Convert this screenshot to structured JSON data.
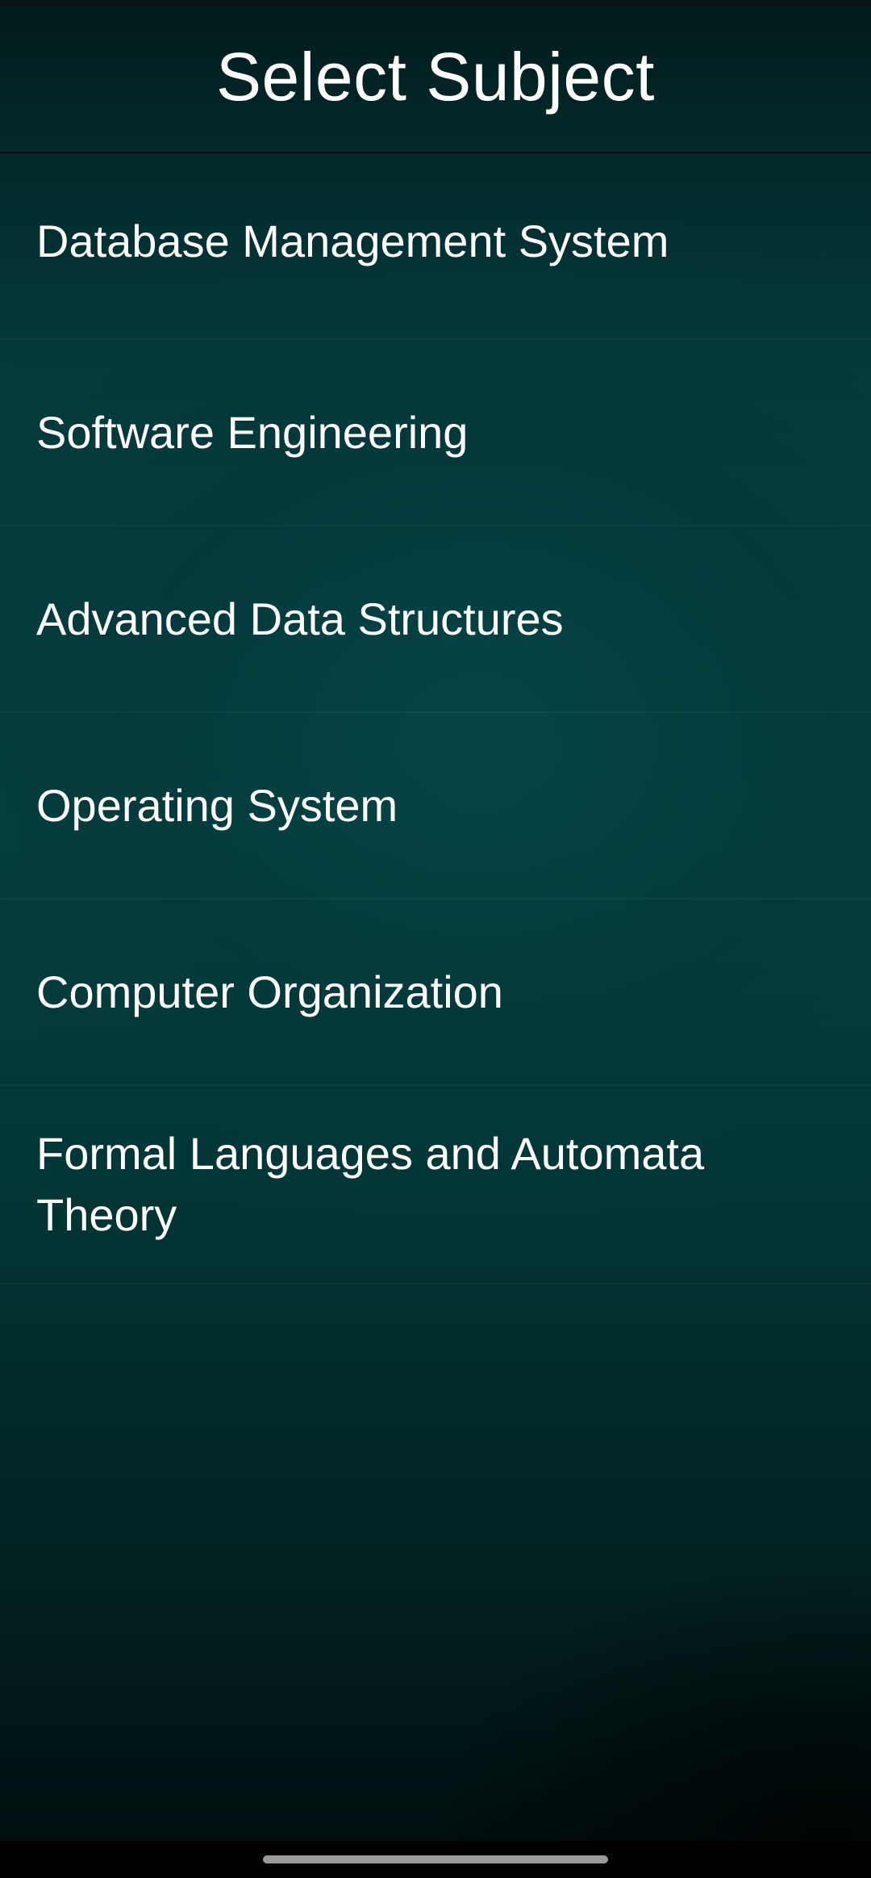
{
  "header": {
    "title": "Select Subject"
  },
  "subjects": [
    {
      "label": "Database Management System"
    },
    {
      "label": "Software Engineering"
    },
    {
      "label": "Advanced Data Structures"
    },
    {
      "label": "Operating System"
    },
    {
      "label": "Computer Organization"
    },
    {
      "label": "Formal Languages and Automata Theory"
    }
  ],
  "colors": {
    "background_top": "#043a3c",
    "background_bottom": "#010f10",
    "text": "#ffffff",
    "home_indicator": "#9a9a9a"
  }
}
